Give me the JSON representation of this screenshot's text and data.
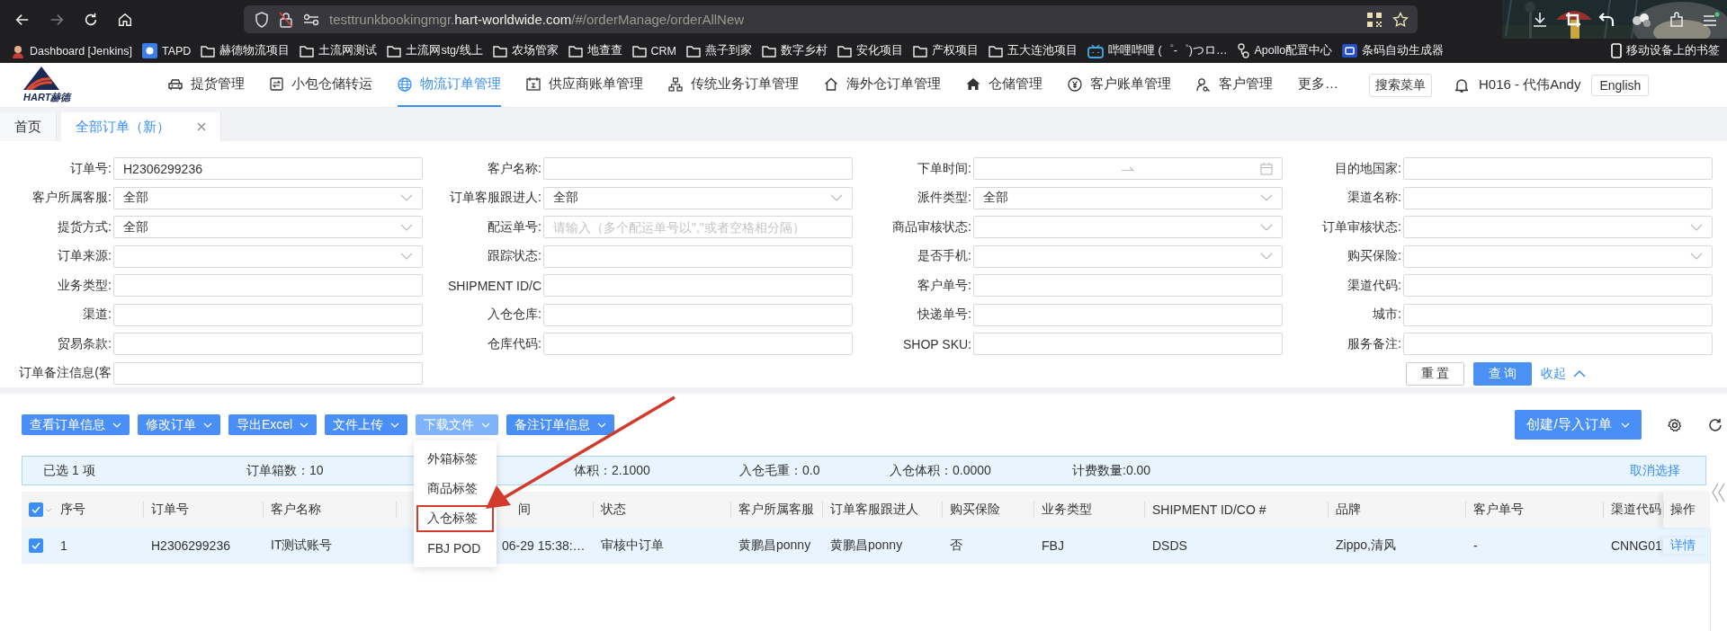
{
  "browser": {
    "forward_disabled": true,
    "url_parts": [
      {
        "text": "testtrunkbookingmgr.",
        "emphasis": false
      },
      {
        "text": "hart-worldwide.com",
        "emphasis": true
      },
      {
        "text": "/#/orderManage/orderAllNew",
        "emphasis": false
      }
    ],
    "bookmarks": [
      {
        "label": "Dashboard [Jenkins]",
        "kind": "avatar"
      },
      {
        "label": "TAPD",
        "kind": "tapd"
      },
      {
        "label": "赫德物流项目",
        "kind": "folder"
      },
      {
        "label": "土流网测试",
        "kind": "folder"
      },
      {
        "label": "土流网stg/线上",
        "kind": "folder"
      },
      {
        "label": "农场管家",
        "kind": "folder"
      },
      {
        "label": "地查查",
        "kind": "folder"
      },
      {
        "label": "CRM",
        "kind": "folder"
      },
      {
        "label": "燕子到家",
        "kind": "folder"
      },
      {
        "label": "数字乡村",
        "kind": "folder"
      },
      {
        "label": "安化项目",
        "kind": "folder"
      },
      {
        "label": "产权项目",
        "kind": "folder"
      },
      {
        "label": "五大连池项目",
        "kind": "folder"
      },
      {
        "label": "哔哩哔哩 (゜-゜)つロ…",
        "kind": "tv"
      },
      {
        "label": "Apollo配置中心",
        "kind": "apollo"
      },
      {
        "label": "条码自动生成器",
        "kind": "square"
      }
    ],
    "mobile_bookmarks": "移动设备上的书签"
  },
  "header": {
    "logo_text": "HART赫德",
    "nav": [
      {
        "label": "提货管理",
        "kind": "car",
        "selected": false
      },
      {
        "label": "小包仓储转运",
        "kind": "sync",
        "selected": false
      },
      {
        "label": "物流订单管理",
        "kind": "globe",
        "selected": true
      },
      {
        "label": "供应商账单管理",
        "kind": "calendar",
        "selected": false
      },
      {
        "label": "传统业务订单管理",
        "kind": "sitemap",
        "selected": false
      },
      {
        "label": "海外仓订单管理",
        "kind": "house",
        "selected": false
      },
      {
        "label": "仓储管理",
        "kind": "house-solid",
        "selected": false
      },
      {
        "label": "客户账单管理",
        "kind": "yen",
        "selected": false
      },
      {
        "label": "客户管理",
        "kind": "users",
        "selected": false
      },
      {
        "label": "更多…",
        "kind": "more",
        "selected": false
      }
    ],
    "search_menu": "搜索菜单",
    "user": "H016 - 代伟Andy",
    "language": "English"
  },
  "tabs": [
    {
      "label": "首页",
      "selected": false,
      "closable": false
    },
    {
      "label": "全部订单（新）",
      "selected": true,
      "closable": true
    }
  ],
  "form": {
    "fields": [
      {
        "label": "订单号:",
        "kind": "text",
        "value": "H2306299236"
      },
      {
        "label": "客户名称:",
        "kind": "text"
      },
      {
        "label": "下单时间:",
        "kind": "daterange"
      },
      {
        "label": "目的地国家:",
        "kind": "text"
      },
      {
        "label": "客户所属客服:",
        "kind": "select",
        "value": "全部"
      },
      {
        "label": "订单客服跟进人:",
        "kind": "select",
        "value": "全部"
      },
      {
        "label": "派件类型:",
        "kind": "select",
        "value": "全部"
      },
      {
        "label": "渠道名称:",
        "kind": "text"
      },
      {
        "label": "提货方式:",
        "kind": "select",
        "value": "全部"
      },
      {
        "label": "配运单号:",
        "kind": "text",
        "placeholder": "请输入（多个配运单号以\",\"或者空格相分隔）"
      },
      {
        "label": "商品审核状态:",
        "kind": "select"
      },
      {
        "label": "订单审核状态:",
        "kind": "select"
      },
      {
        "label": "订单来源:",
        "kind": "select"
      },
      {
        "label": "跟踪状态:",
        "kind": "text"
      },
      {
        "label": "是否手机:",
        "kind": "select"
      },
      {
        "label": "购买保险:",
        "kind": "select"
      },
      {
        "label": "业务类型:",
        "kind": "text"
      },
      {
        "label": "SHIPMENT ID/C",
        "kind": "text"
      },
      {
        "label": "客户单号:",
        "kind": "text"
      },
      {
        "label": "渠道代码:",
        "kind": "text"
      },
      {
        "label": "渠道:",
        "kind": "text"
      },
      {
        "label": "入仓仓库:",
        "kind": "text"
      },
      {
        "label": "快递单号:",
        "kind": "text"
      },
      {
        "label": "城市:",
        "kind": "text"
      },
      {
        "label": "贸易条款:",
        "kind": "text"
      },
      {
        "label": "仓库代码:",
        "kind": "text"
      },
      {
        "label": "SHOP SKU:",
        "kind": "text"
      },
      {
        "label": "服务备注:",
        "kind": "text"
      },
      {
        "label": "订单备注信息(客",
        "kind": "text"
      }
    ],
    "reset": "重 置",
    "query": "查 询",
    "collapse": "收起"
  },
  "toolbar": {
    "buttons": [
      {
        "label": "查看订单信息",
        "open": false
      },
      {
        "label": "修改订单",
        "open": false
      },
      {
        "label": "导出Excel",
        "open": false
      },
      {
        "label": "文件上传",
        "open": false
      },
      {
        "label": "下载文件",
        "open": true,
        "menu": [
          {
            "label": "外箱标签",
            "highlighted": false
          },
          {
            "label": "商品标签",
            "highlighted": false
          },
          {
            "label": "入仓标签",
            "highlighted": true
          },
          {
            "label": "FBJ POD",
            "highlighted": false
          }
        ]
      },
      {
        "label": "备注订单信息",
        "open": false
      }
    ],
    "create": "创建/导入订单"
  },
  "summary": {
    "items": [
      "已选 1 项",
      "订单箱数：10",
      "体积：2.1000",
      "入仓毛重：0.0",
      "入仓体积：0.0000",
      "计费数量:0.00"
    ],
    "clear": "取消选择"
  },
  "table": {
    "select_all": true,
    "columns": [
      {
        "label": "序号",
        "kind": "text"
      },
      {
        "label": "订单号",
        "kind": "text"
      },
      {
        "label": "客户名称",
        "kind": "text"
      },
      {
        "label": "间",
        "kind": "text"
      },
      {
        "label": "状态",
        "kind": "text"
      },
      {
        "label": "客户所属客服",
        "kind": "text"
      },
      {
        "label": "订单客服跟进人",
        "kind": "text"
      },
      {
        "label": "购买保险",
        "kind": "text"
      },
      {
        "label": "业务类型",
        "kind": "text"
      },
      {
        "label": "SHIPMENT ID/CO #",
        "kind": "text"
      },
      {
        "label": "品牌",
        "kind": "text"
      },
      {
        "label": "客户单号",
        "kind": "text"
      },
      {
        "label": "渠道代码",
        "kind": "text"
      },
      {
        "label": "操作",
        "kind": "link"
      }
    ],
    "rows": [
      {
        "selected": true,
        "cells": [
          "1",
          "H2306299236",
          "IT测试账号",
          "06-29 15:38:…",
          "审核中订单",
          "黄鹏昌ponny",
          "黄鹏昌ponny",
          "否",
          "FBJ",
          "DSDS",
          "Zippo,清风",
          "-",
          "CNNG01",
          "详情"
        ]
      }
    ]
  }
}
